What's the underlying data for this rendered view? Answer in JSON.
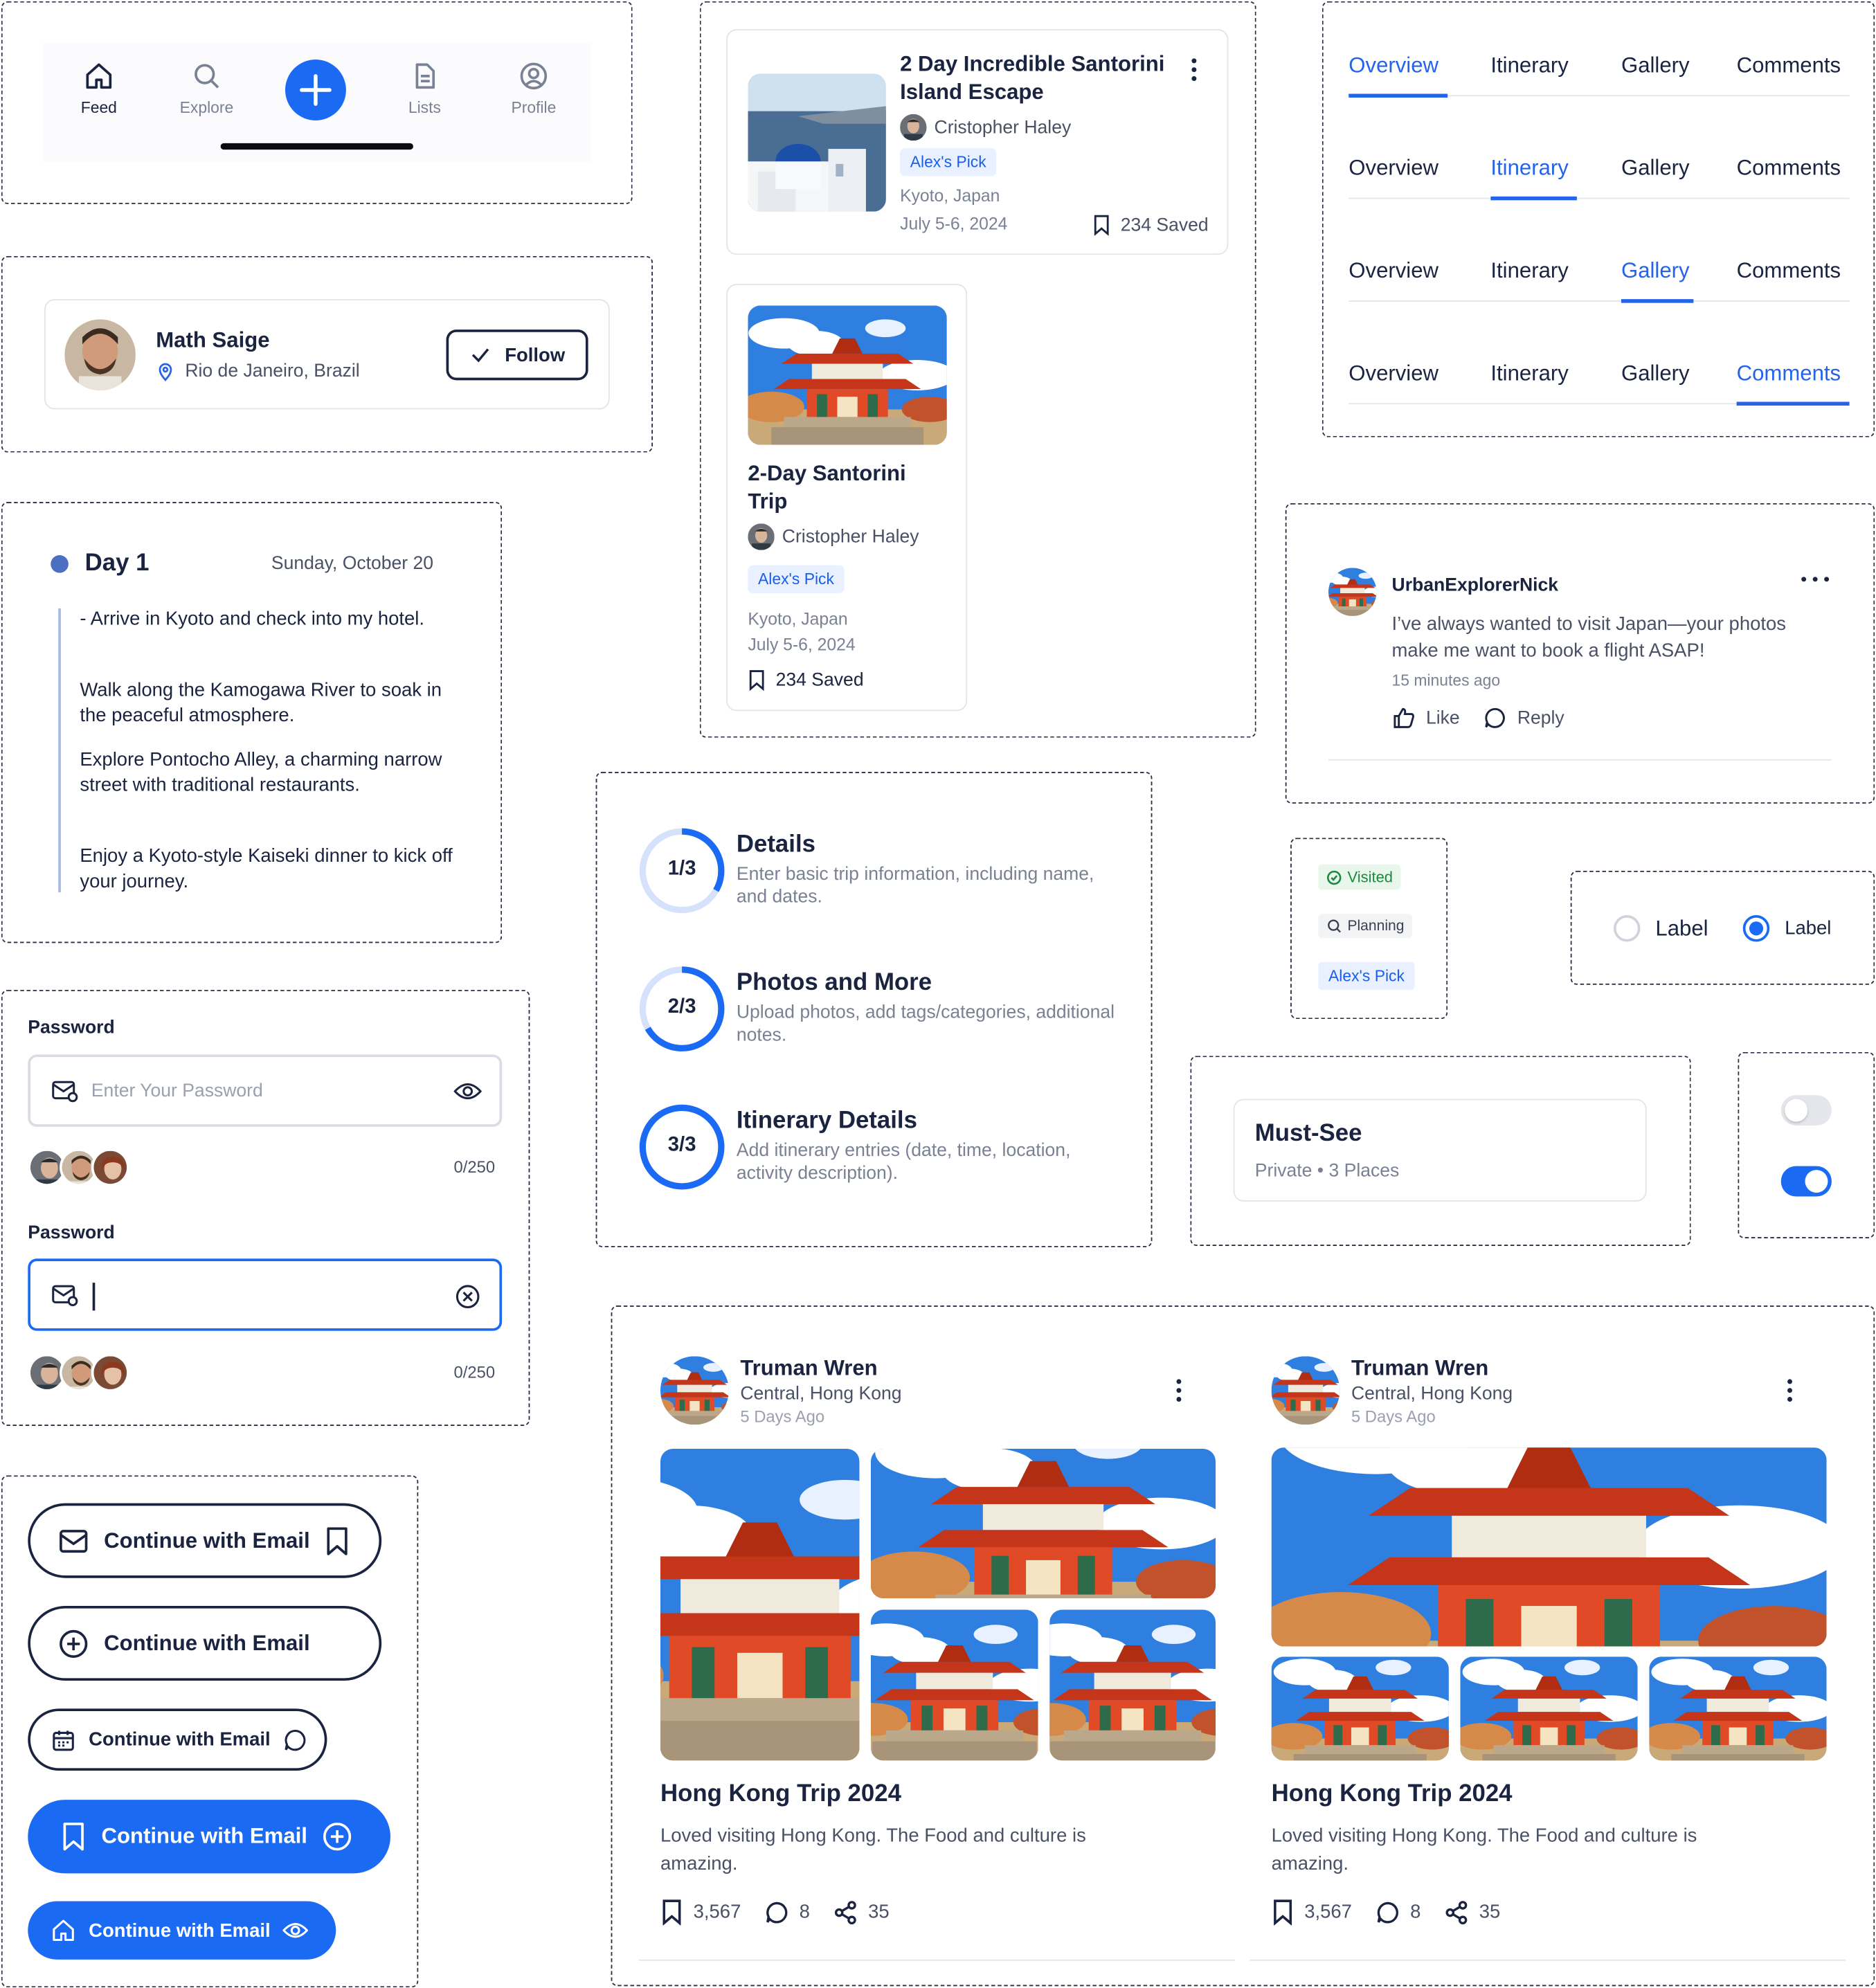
{
  "bottom_nav": {
    "items": [
      {
        "label": "Feed",
        "icon": "home-icon",
        "active": true
      },
      {
        "label": "Explore",
        "icon": "search-icon",
        "active": false
      },
      {
        "label": "",
        "icon": "plus-icon",
        "active": false
      },
      {
        "label": "Lists",
        "icon": "document-icon",
        "active": false
      },
      {
        "label": "Profile",
        "icon": "user-circle-icon",
        "active": false
      }
    ]
  },
  "profile_card": {
    "name": "Math Saige",
    "location": "Rio de Janeiro, Brazil",
    "follow_label": "Follow"
  },
  "day_itinerary": {
    "day_label": "Day 1",
    "date": "Sunday, October 20",
    "entries": [
      "- Arrive in Kyoto and check into my hotel.",
      "Walk along the Kamogawa River to soak in the peaceful atmosphere.",
      "Explore Pontocho Alley, a charming narrow street with traditional restaurants.",
      "Enjoy a Kyoto-style Kaiseki dinner to kick off your journey."
    ]
  },
  "password_fields": [
    {
      "label": "Password",
      "placeholder": "Enter Your Password",
      "value": "",
      "counter": "0/250",
      "state": "default"
    },
    {
      "label": "Password",
      "placeholder": "",
      "value": "",
      "counter": "0/250",
      "state": "focused"
    }
  ],
  "social_buttons": [
    {
      "label": "Continue with Email",
      "left_icon": "mail-icon",
      "right_icon": "bookmark-icon",
      "style": "outline-large"
    },
    {
      "label": "Continue with Email",
      "left_icon": "plus-circle-icon",
      "right_icon": "",
      "style": "outline-large"
    },
    {
      "label": "Continue with Email",
      "left_icon": "calendar-icon",
      "right_icon": "chat-icon",
      "style": "outline-small"
    },
    {
      "label": "Continue with Email",
      "left_icon": "bookmark-icon",
      "right_icon": "plus-circle-icon",
      "style": "solid-large"
    },
    {
      "label": "Continue with Email",
      "left_icon": "home-icon",
      "right_icon": "eye-icon",
      "style": "solid-small"
    }
  ],
  "trip_card_wide": {
    "title": "2 Day Incredible Santorini Island Escape",
    "author": "Cristopher Haley",
    "tag": "Alex's Pick",
    "location": "Kyoto, Japan",
    "dates": "July 5-6, 2024",
    "saved": "234 Saved"
  },
  "trip_card_tall": {
    "title": "2-Day Santorini Trip",
    "author": "Cristopher Haley",
    "tag": "Alex's Pick",
    "location": "Kyoto, Japan",
    "dates": "July 5-6, 2024",
    "saved": "234 Saved"
  },
  "tabs": {
    "labels": [
      "Overview",
      "Itinerary",
      "Gallery",
      "Comments"
    ],
    "rows_active": [
      "Overview",
      "Itinerary",
      "Gallery",
      "Comments"
    ]
  },
  "comment": {
    "user": "UrbanExplorerNick",
    "text": "I’ve always wanted to visit Japan—your photos make me want to book a flight ASAP!",
    "time": "15 minutes ago",
    "like_label": "Like",
    "reply_label": "Reply"
  },
  "steps": [
    {
      "progress": "1/3",
      "title": "Details",
      "description": "Enter basic trip information, including name, and dates.",
      "fraction": 0.333
    },
    {
      "progress": "2/3",
      "title": "Photos and More",
      "description": "Upload photos, add tags/categories, additional notes.",
      "fraction": 0.667
    },
    {
      "progress": "3/3",
      "title": "Itinerary Details",
      "description": "Add itinerary entries (date, time, location, activity description).",
      "fraction": 1.0
    }
  ],
  "badges": [
    {
      "label": "Visited",
      "icon": "check-pin-icon",
      "color": "#1b8a3c"
    },
    {
      "label": "Planning",
      "icon": "search-pin-icon",
      "color": "#3a3f52"
    },
    {
      "label": "Alex's Pick",
      "icon": "",
      "color": "#1a5ee9"
    }
  ],
  "radios": [
    {
      "label": "Label",
      "checked": false
    },
    {
      "label": "Label",
      "checked": true
    }
  ],
  "list_card": {
    "title": "Must-See",
    "meta": "Private • 3 Places"
  },
  "toggles": [
    {
      "on": false
    },
    {
      "on": true
    }
  ],
  "posts": [
    {
      "author": "Truman Wren",
      "location": "Central, Hong Kong",
      "time": "5 Days Ago",
      "title": "Hong Kong Trip 2024",
      "body": "Loved visiting Hong Kong. The Food and culture is amazing.",
      "saves": "3,567",
      "comments": "8",
      "shares": "35",
      "layout": "grid-left-tall"
    },
    {
      "author": "Truman Wren",
      "location": "Central, Hong Kong",
      "time": "5 Days Ago",
      "title": "Hong Kong Trip 2024",
      "body": "Loved visiting Hong Kong. The Food and culture is amazing.",
      "saves": "3,567",
      "comments": "8",
      "shares": "35",
      "layout": "hero-top"
    }
  ],
  "colors": {
    "primary": "#1a6af4",
    "text": "#1a2340",
    "muted": "#7a8194",
    "tag_bg": "#e9f0ff"
  }
}
